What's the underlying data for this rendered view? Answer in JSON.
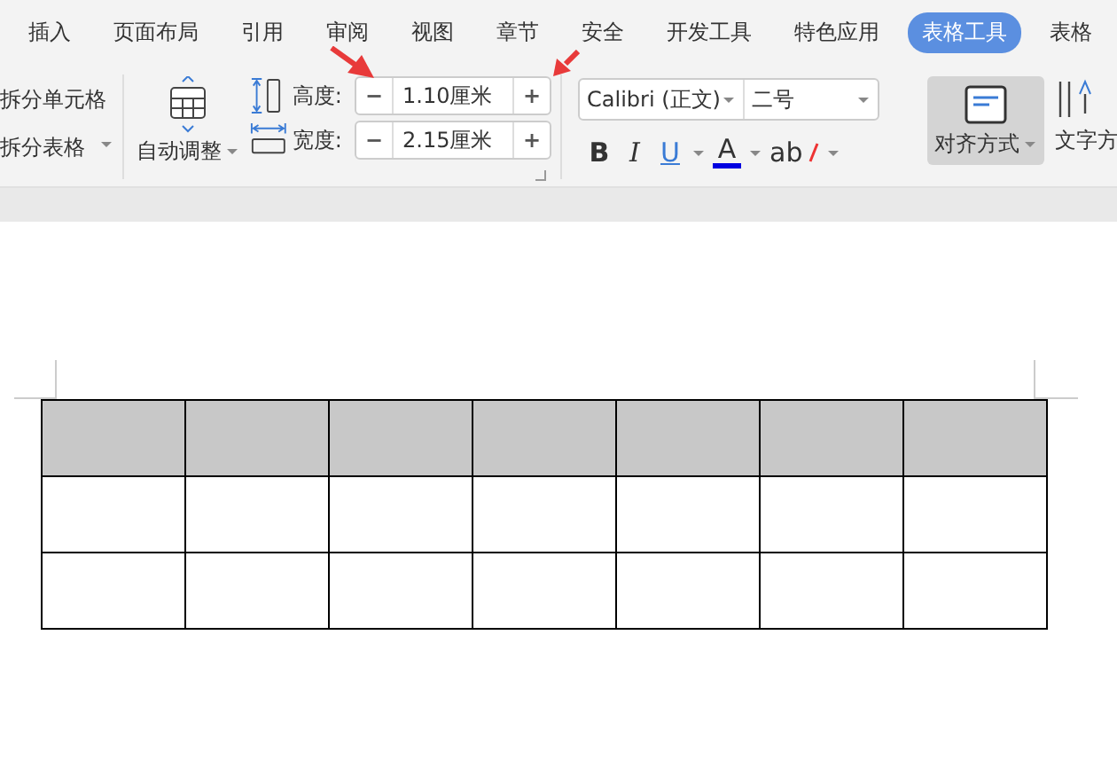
{
  "tabs": [
    {
      "label": "插入",
      "selected": false
    },
    {
      "label": "页面布局",
      "selected": false
    },
    {
      "label": "引用",
      "selected": false
    },
    {
      "label": "审阅",
      "selected": false
    },
    {
      "label": "视图",
      "selected": false
    },
    {
      "label": "章节",
      "selected": false
    },
    {
      "label": "安全",
      "selected": false
    },
    {
      "label": "开发工具",
      "selected": false
    },
    {
      "label": "特色应用",
      "selected": false
    },
    {
      "label": "表格工具",
      "selected": true
    },
    {
      "label": "表格",
      "selected": false
    }
  ],
  "ribbon": {
    "split_cell": "拆分单元格",
    "split_table": "拆分表格",
    "autofit": "自动调整",
    "height": {
      "label": "高度:",
      "minus": "−",
      "value": "1.10厘米",
      "plus": "+"
    },
    "width": {
      "label": "宽度:",
      "minus": "−",
      "value": "2.15厘米",
      "plus": "+"
    },
    "font": "Calibri (正文)",
    "size": "二号",
    "bold": "B",
    "italic": "I",
    "underline": "U",
    "font_color": "A",
    "highlight": "ab",
    "align": {
      "label": "对齐方式",
      "pressed": true
    },
    "text_direction": "文字方"
  },
  "table": {
    "rows": [
      {
        "shaded": true
      },
      {
        "shaded": false
      },
      {
        "shaded": false
      }
    ]
  }
}
